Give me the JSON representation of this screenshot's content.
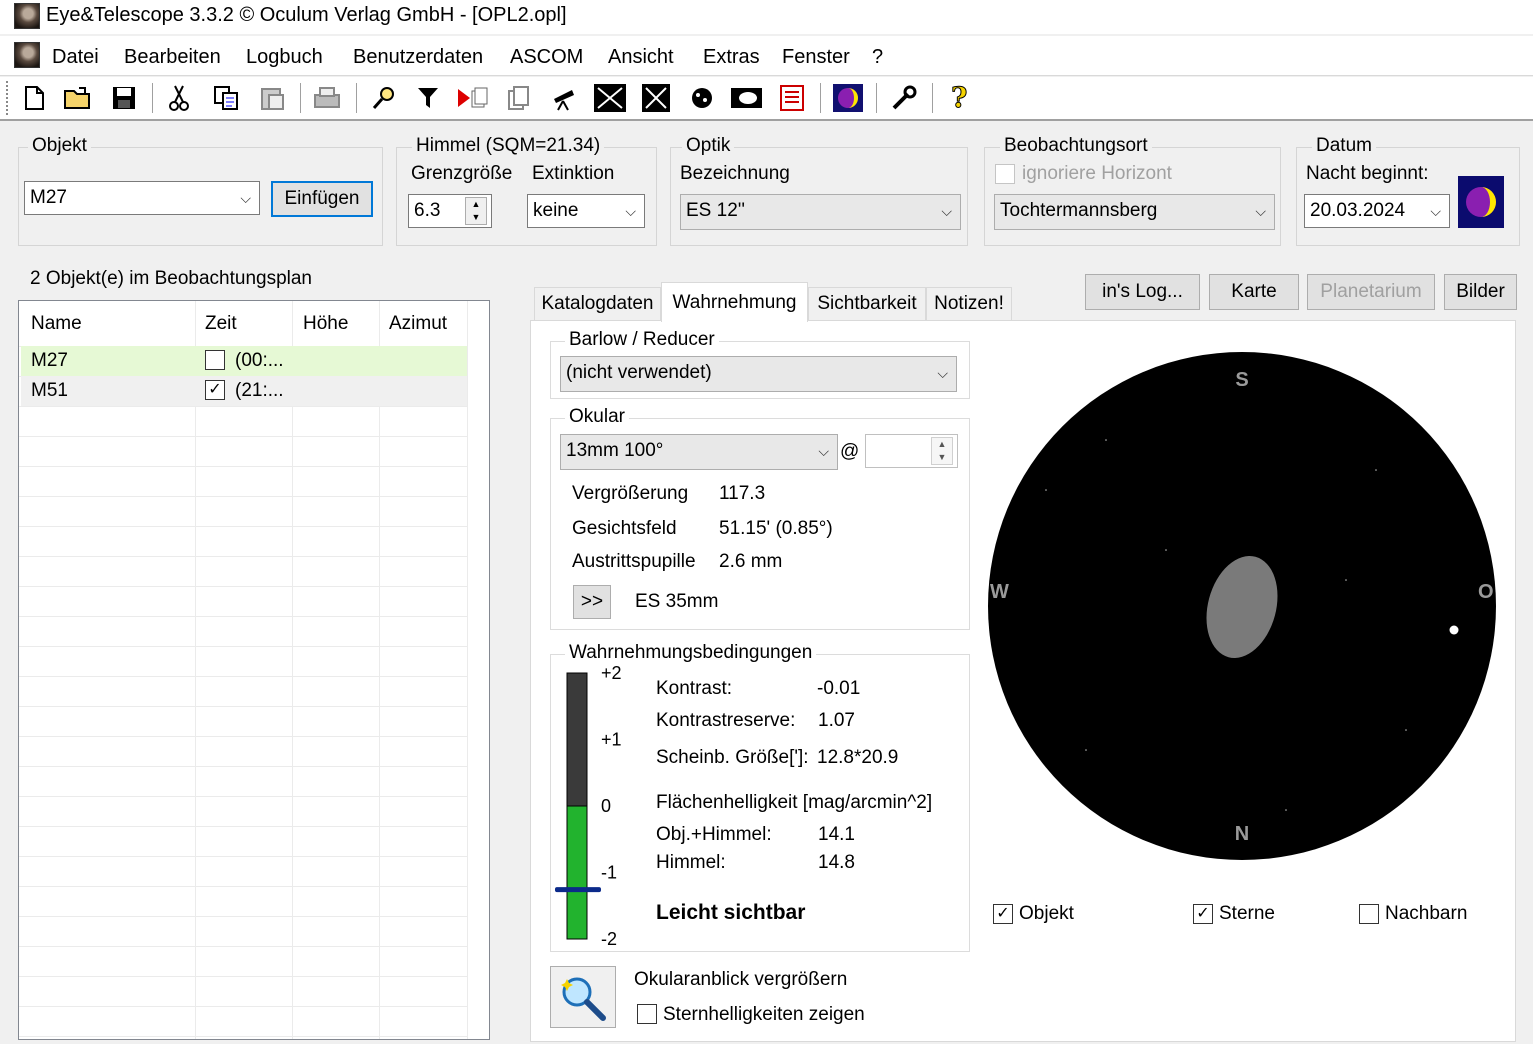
{
  "window": {
    "title": "Eye&Telescope 3.3.2 © Oculum Verlag GmbH - [OPL2.opl]"
  },
  "menu": [
    "Datei",
    "Bearbeiten",
    "Logbuch",
    "Benutzerdaten",
    "ASCOM",
    "Ansicht",
    "Extras",
    "Fenster",
    "?"
  ],
  "toolbar": {
    "icons": [
      "new-file-icon",
      "open-folder-icon",
      "save-icon",
      "cut-icon",
      "copy-icon",
      "paste-icon",
      "print-icon",
      "search-icon",
      "filter-icon",
      "play-icon",
      "copy-pages-icon",
      "pages-icon",
      "telescope-icon",
      "constellation-icon",
      "deep-sky-icon",
      "planet-icon",
      "eyepiece-icon",
      "book-icon",
      "moon-phase-icon",
      "tools-icon",
      "help-icon"
    ]
  },
  "objekt": {
    "group_label": "Objekt",
    "value": "M27",
    "insert_button": "Einfügen"
  },
  "himmel": {
    "group_label": "Himmel (SQM=21.34)",
    "grenz_label": "Grenzgröße",
    "grenz_value": "6.3",
    "ext_label": "Extinktion",
    "ext_value": "keine"
  },
  "optik": {
    "group_label": "Optik",
    "bez_label": "Bezeichnung",
    "bez_value": "ES 12''"
  },
  "ort": {
    "group_label": "Beobachtungsort",
    "ignore_label": "ignoriere Horizont",
    "ignore_checked": false,
    "value": "Tochtermannsberg"
  },
  "datum": {
    "group_label": "Datum",
    "nacht_label": "Nacht beginnt:",
    "value": "20.03.2024"
  },
  "plan": {
    "count_label": "2 Objekt(e) im Beobachtungsplan",
    "columns": [
      "Name",
      "Zeit",
      "Höhe",
      "Azimut"
    ],
    "rows": [
      {
        "name": "M27",
        "zeit": "(00:...",
        "hoehe": "",
        "azimut": "",
        "checked": false,
        "highlight": "#e6f9d5"
      },
      {
        "name": "M51",
        "zeit": "(21:...",
        "hoehe": "",
        "azimut": "",
        "checked": true,
        "highlight": "#f0f0f0"
      }
    ]
  },
  "actions": {
    "log": "in's Log...",
    "karte": "Karte",
    "planetarium": "Planetarium",
    "bilder": "Bilder"
  },
  "tabs": [
    "Katalogdaten",
    "Wahrnehmung",
    "Sichtbarkeit",
    "Notizen!"
  ],
  "active_tab": "Wahrnehmung",
  "barlow": {
    "group_label": "Barlow / Reducer",
    "value": "(nicht verwendet)"
  },
  "okular": {
    "group_label": "Okular",
    "value": "13mm 100°",
    "at": "@",
    "spin_value": "",
    "rows": [
      {
        "label": "Vergrößerung",
        "value": "117.3"
      },
      {
        "label": "Gesichtsfeld",
        "value": "51.15' (0.85°)"
      },
      {
        "label": "Austrittspupille",
        "value": "2.6 mm"
      }
    ],
    "next_button": ">>",
    "next_label": "ES 35mm"
  },
  "bedingungen": {
    "group_label": "Wahrnehmungsbedingungen",
    "scale_ticks": [
      "+2",
      "+1",
      "0",
      "-1",
      "-2"
    ],
    "indicator_value": -1.25,
    "kontrast_label": "Kontrast:",
    "kontrast_value": "-0.01",
    "reserve_label": "Kontrastreserve:",
    "reserve_value": "1.07",
    "groesse_label": "Scheinb. Größe[']:",
    "groesse_value": "12.8*20.9",
    "flaeche_label": "Flächenhelligkeit [mag/arcmin^2]",
    "obj_label": "Obj.+Himmel:",
    "obj_value": "14.1",
    "himmel_label": "Himmel:",
    "himmel_value": "14.8",
    "result": "Leicht sichtbar"
  },
  "ansicht": {
    "zoom_label": "Okularanblick vergrößern",
    "sternhell_label": "Sternhelligkeiten zeigen",
    "sternhell_checked": false
  },
  "field_view": {
    "north": "N",
    "south": "S",
    "west": "W",
    "east": "O"
  },
  "view_options": [
    {
      "label": "Objekt",
      "checked": true
    },
    {
      "label": "Sterne",
      "checked": true
    },
    {
      "label": "Nachbarn",
      "checked": false
    }
  ],
  "colors": {
    "contrast_green": "#22b32e",
    "contrast_dark": "#3a3a3a",
    "indicator": "#0b2a8a",
    "row_highlight": "#e6f9d5",
    "object_gray": "#7a7a7a"
  }
}
